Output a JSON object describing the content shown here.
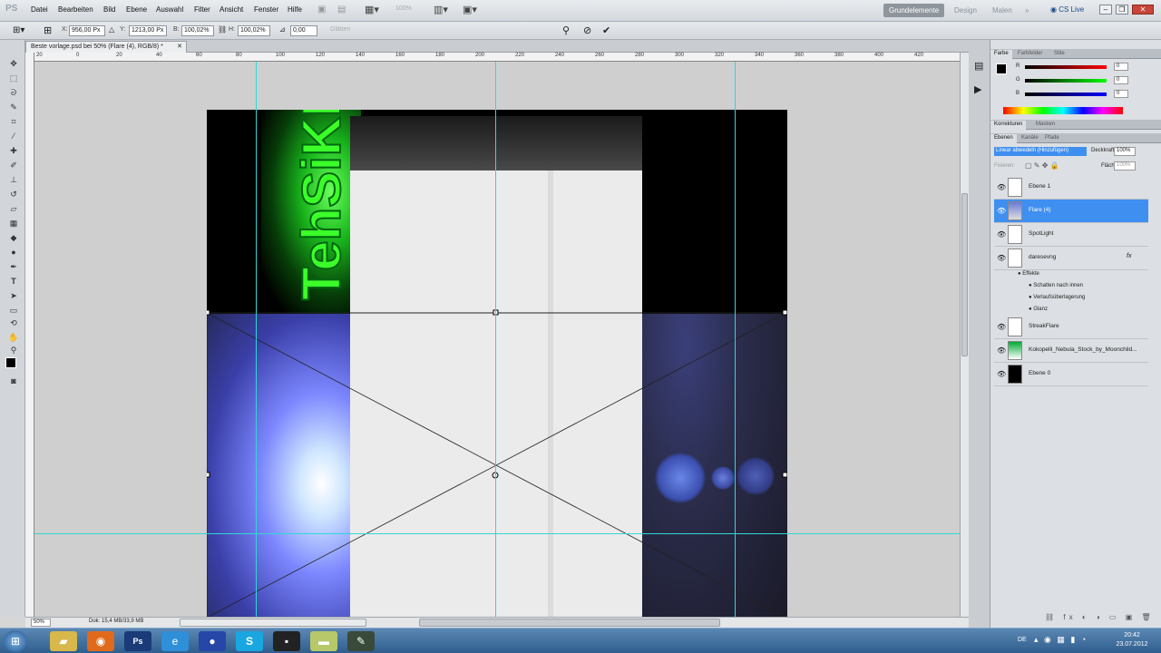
{
  "app": {
    "logo": "PS"
  },
  "menu": [
    "Datei",
    "Bearbeiten",
    "Bild",
    "Ebene",
    "Auswahl",
    "Filter",
    "Ansicht",
    "Fenster",
    "Hilfe"
  ],
  "zoom_menu": "100%",
  "workspaces": {
    "grundelemente": "Grundelemente",
    "design": "Design",
    "malen": "Malen",
    "more": "»",
    "cslive": "CS Live"
  },
  "options": {
    "x_label": "X:",
    "x_value": "956,00 Px",
    "y_label": "Y:",
    "y_value": "1213,00 Px",
    "b_label": "B:",
    "b_value": "100,02%",
    "h_label": "H:",
    "h_value": "100,02%",
    "angle_value": "0,00",
    "interp_label": "Glätten"
  },
  "document": {
    "tab_title": "Beste vorlage.psd bei 50% (Flare (4), RGB/8) *",
    "text_art": "TehSiKK"
  },
  "ruler_ticks": [
    "20",
    "0",
    "20",
    "40",
    "60",
    "80",
    "100",
    "120",
    "140",
    "160",
    "180",
    "200",
    "220",
    "240",
    "260",
    "280",
    "300",
    "320",
    "340",
    "360",
    "380",
    "400",
    "420"
  ],
  "status": {
    "zoom": "50%",
    "doc": "Dok: 15,4 MB/33,9 MB"
  },
  "color_panel": {
    "tabs": [
      "Farbe",
      "Farbfelder",
      "Stile"
    ],
    "channels": [
      {
        "label": "R",
        "value": "0"
      },
      {
        "label": "G",
        "value": "0"
      },
      {
        "label": "B",
        "value": "0"
      }
    ]
  },
  "adjust_tabs": [
    "Korrekturen",
    "Masken"
  ],
  "layers_panel": {
    "tabs": [
      "Ebenen",
      "Kanäle",
      "Pfade"
    ],
    "blend_mode": "Linear abwedeln (Hinzufügen)",
    "opacity_label": "Deckkraft:",
    "opacity_value": "100%",
    "lock_label": "Fixieren:",
    "fill_label": "Fläche:",
    "fill_value": "100%",
    "layers": [
      {
        "name": "Ebene 1",
        "selected": false
      },
      {
        "name": "Flare (4)",
        "selected": true
      },
      {
        "name": "SpotLight",
        "selected": false
      },
      {
        "name": "daresevng",
        "selected": false,
        "fx": "fx"
      },
      {
        "name": "StreakFlare",
        "selected": false
      },
      {
        "name": "Kokopelli_Nebula_Stock_by_Moonchild...",
        "selected": false
      },
      {
        "name": "Ebene 0",
        "selected": false
      }
    ],
    "effects_label": "Effekte",
    "effects": [
      "Schatten nach innen",
      "Verlaufsüberlagerung",
      "Glanz"
    ]
  },
  "tray": {
    "lang": "DE",
    "time": "20:42",
    "date": "23.07.2012"
  },
  "colors": {
    "selection": "#3f8ff0",
    "accent_green": "#27e026",
    "taskbar": "#2f5e8e"
  }
}
